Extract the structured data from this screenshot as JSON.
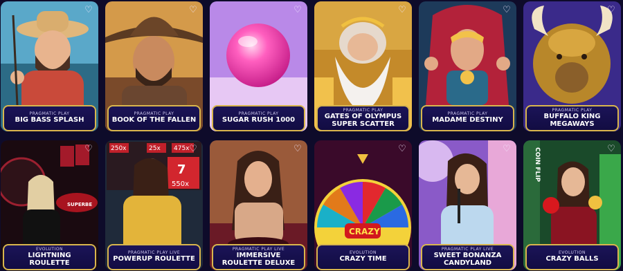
{
  "games": [
    {
      "provider": "PRAGMATIC PLAY",
      "title": "BIG BASS SPLASH"
    },
    {
      "provider": "PRAGMATIC PLAY",
      "title": "BOOK OF THE FALLEN"
    },
    {
      "provider": "PRAGMATIC PLAY",
      "title": "SUGAR RUSH 1000"
    },
    {
      "provider": "PRAGMATIC PLAY",
      "title": "GATES OF OLYMPUS SUPER SCATTER"
    },
    {
      "provider": "PRAGMATIC PLAY",
      "title": "MADAME DESTINY"
    },
    {
      "provider": "PRAGMATIC PLAY",
      "title": "BUFFALO KING MEGAWAYS"
    },
    {
      "provider": "EVOLUTION",
      "title": "LIGHTNING ROULETTE"
    },
    {
      "provider": "PRAGMATIC PLAY LIVE",
      "title": "POWERUP ROULETTE"
    },
    {
      "provider": "PRAGMATIC PLAY LIVE",
      "title": "IMMERSIVE ROULETTE DELUXE"
    },
    {
      "provider": "EVOLUTION",
      "title": "CRAZY TIME"
    },
    {
      "provider": "PRAGMATIC PLAY LIVE",
      "title": "SWEET BONANZA CANDYLAND"
    },
    {
      "provider": "EVOLUTION",
      "title": "CRAZY BALLS"
    }
  ],
  "art_text": {
    "powerup_multipliers": [
      "250x",
      "25x",
      "475x",
      "7",
      "550x"
    ],
    "crazy_time_logo": "CRAZY",
    "coin_flip": "COIN FLIP",
    "lightning_sign": "SUPERBE"
  },
  "colors": {
    "page_bg": "#0e0b2a",
    "plate_bg": "#16104c",
    "plate_border": "#d9b64d"
  },
  "icons": {
    "favorite": "heart-outline-icon"
  }
}
